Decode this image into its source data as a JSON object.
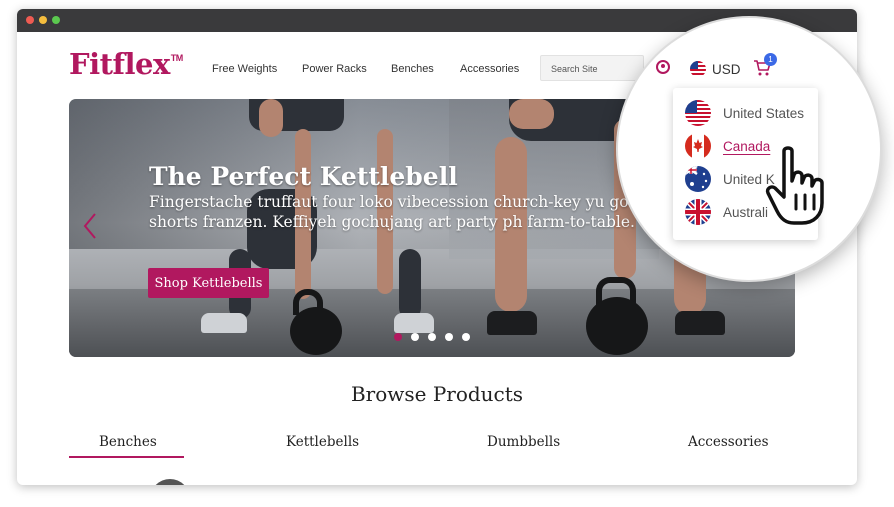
{
  "brand": {
    "name": "Fitflex",
    "trademark": "TM"
  },
  "nav": {
    "items": [
      {
        "label": "Free Weights"
      },
      {
        "label": "Power Racks"
      },
      {
        "label": "Benches"
      },
      {
        "label": "Accessories"
      }
    ],
    "search_placeholder": "Search Site"
  },
  "header": {
    "currency": "USD",
    "cart_count": "1"
  },
  "currency_dropdown": {
    "items": [
      {
        "label": "United States",
        "flag": "us-flag-icon",
        "active": false
      },
      {
        "label": "Canada",
        "flag": "canada-flag-icon",
        "active": true
      },
      {
        "label": "United K",
        "flag": "australia-flag-icon",
        "active": false
      },
      {
        "label": "Australi",
        "flag": "uk-flag-icon",
        "active": false
      }
    ]
  },
  "hero": {
    "title": "The Perfect Kettlebell",
    "text": "Fingerstache truffaut four loko vibecession church-key yu godard jean shorts franzen. Keffiyeh gochujang art party ph farm-to-table.",
    "button_label": "Shop Kettlebells",
    "slide_count": 5,
    "active_slide": 1
  },
  "browse": {
    "title": "Browse Products",
    "tabs": [
      {
        "label": "Benches",
        "active": true
      },
      {
        "label": "Kettlebells",
        "active": false
      },
      {
        "label": "Dumbbells",
        "active": false
      },
      {
        "label": "Accessories",
        "active": false
      }
    ]
  },
  "colors": {
    "accent": "#b1185f",
    "badge": "#3b69e6"
  }
}
